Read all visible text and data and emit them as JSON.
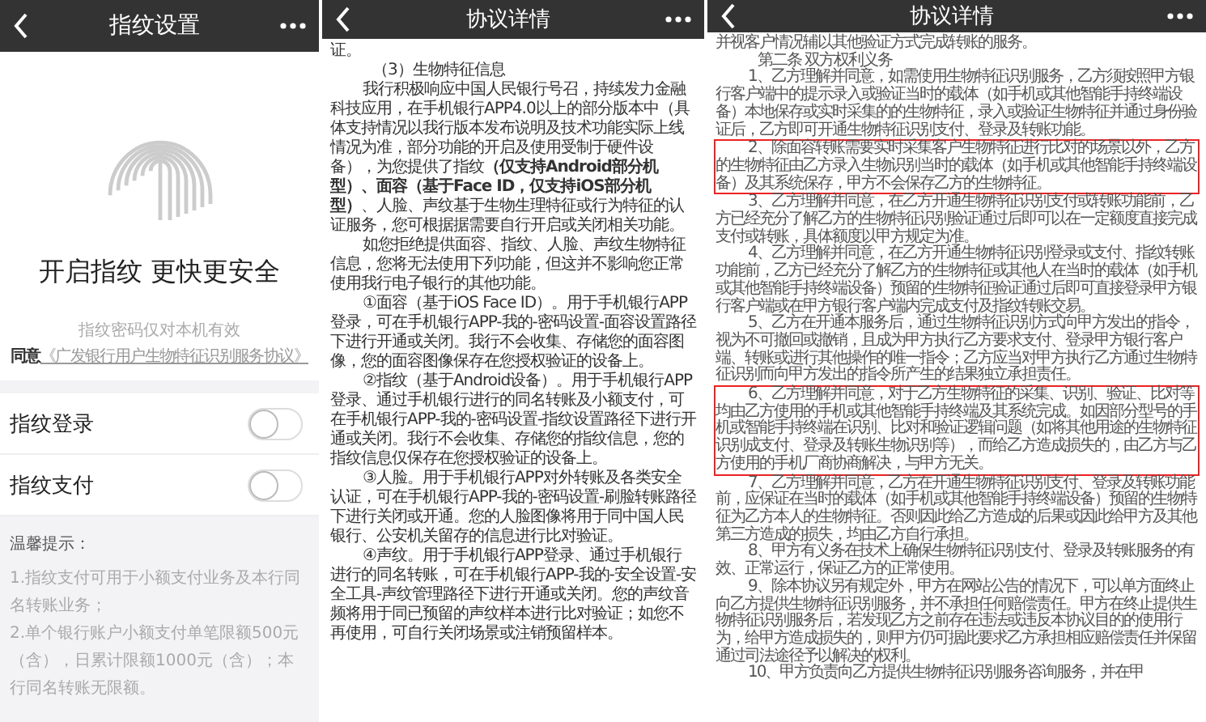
{
  "screens": [
    {
      "kind": "settings",
      "header": {
        "title": "指纹设置"
      },
      "hero": {
        "title": "开启指纹 更快更安全",
        "note": "指纹密码仅对本机有效",
        "agree": "同意",
        "agreement_link": "《广发银行用户生物特征识别服务协议》"
      },
      "toggles": [
        {
          "label": "指纹登录",
          "on": false
        },
        {
          "label": "指纹支付",
          "on": false
        }
      ],
      "tips": {
        "title": "温馨提示：",
        "lines": [
          "1.指纹支付可用于小额支付业务及本行同名转账业务；",
          "2.单个银行账户小额支付单笔限额500元（含），日累计限额1000元（含）；本行同名转账无限额。"
        ]
      }
    },
    {
      "kind": "agreement",
      "header": {
        "title": "协议详情"
      },
      "paragraphs": [
        {
          "kind": "continuation",
          "text": "证。"
        },
        {
          "kind": "heading",
          "text": "（3）生物特征信息"
        },
        {
          "kind": "body",
          "text": "我行积极响应中国人民银行号召，持续发力金融科技应用，在手机银行APP4.0以上的部分版本中（具体支持情况以我行版本发布说明及技术功能实际上线情况为准，部分功能的开启及使用受制于硬件设备），为您提供了指纹**（仅支持Android部分机型）、面容（基于Face ID，仅支持iOS部分机型）**、人脸、声纹基于生物生理特征或行为特征的认证服务，您可根据据需要自行开启或关闭相关功能。"
        },
        {
          "kind": "body",
          "text": "如您拒绝提供面容、指纹、人脸、声纹生物特征信息，您将无法使用下列功能，但这并不影响您正常使用我行电子银行的其他功能。"
        },
        {
          "kind": "body",
          "text": "①面容（基于iOS Face ID）。用于手机银行APP登录，可在手机银行APP-我的-密码设置-面容设置路径下进行开通或关闭。我行不会收集、存储您的面容图像，您的面容图像保存在您授权验证的设备上。"
        },
        {
          "kind": "body",
          "text": "②指纹（基于Android设备）。用于手机银行APP登录、通过手机银行进行的同名转账及小额支付，可在手机银行APP-我的-密码设置-指纹设置路径下进行开通或关闭。我行不会收集、存储您的指纹信息，您的指纹信息仅保存在您授权验证的设备上。"
        },
        {
          "kind": "body",
          "text": "③人脸。用于手机银行APP对外转账及各类安全认证，可在手机银行APP-我的-密码设置-刷脸转账路径下进行关闭或开通。您的人脸图像将用于同中国人民银行、公安机关留存的信息进行比对验证。"
        },
        {
          "kind": "body",
          "text": "④声纹。用于手机银行APP登录、通过手机银行进行的同名转账，可在手机银行APP-我的-安全设置-安全工具-声纹管理路径下进行开通或关闭。您的声纹音频将用于同已预留的声纹样本进行比对验证；如您不再使用，可自行关闭场景或注销预留样本。"
        }
      ]
    },
    {
      "kind": "agreement",
      "header": {
        "title": "协议详情"
      },
      "paragraphs": [
        {
          "kind": "continuation",
          "text": "并视客户情况辅以其他验证方式完成转账的服务。",
          "highlighted": false
        },
        {
          "kind": "heading",
          "text": "第二条 双方权利义务",
          "highlighted": false
        },
        {
          "kind": "body",
          "text": "1、乙方理解并同意，如需使用生物特征识别服务，乙方须按照甲方银行客户端中的提示录入或验证当时的载体（如手机或其他智能手持终端设备）本地保存或实时采集的的生物特征，录入或验证生物特征并通过身份验证后，乙方即可开通生物特征识别支付、登录及转账功能。",
          "highlighted": false
        },
        {
          "kind": "body",
          "text": "2、除面容转账需要实时采集客户生物特征进行比对的场景以外，乙方的生物特征由乙方录入生物识别当时的载体（如手机或其他智能手持终端设备）及其系统保存，甲方不会保存乙方的生物特征。",
          "highlighted": true
        },
        {
          "kind": "body",
          "text": "3、乙方理解并同意，在乙方开通生物特征识别支付或转账功能前，乙方已经充分了解乙方的生物特征识别验证通过后即可以在一定额度直接完成支付或转账，具体额度以甲方规定为准。",
          "highlighted": false
        },
        {
          "kind": "body",
          "text": "4、乙方理解并同意，在乙方开通生物特征识别登录或支付、指纹转账功能前，乙方已经充分了解乙方的生物特征或其他人在当时的载体（如手机或其他智能手持终端设备）预留的生物特征验证通过后即可直接登录甲方银行客户端或在甲方银行客户端内完成支付及指纹转账交易。",
          "highlighted": false
        },
        {
          "kind": "body",
          "text": "5、乙方在开通本服务后，通过生物特征识别方式向甲方发出的指令，视为不可撤回或撤销，且成为甲方执行乙方要求支付、登录甲方银行客户端、转账或进行其他操作的唯一指令；乙方应当对甲方执行乙方通过生物特征识别而向甲方发出的指令所产生的结果独立承担责任。",
          "highlighted": false
        },
        {
          "kind": "body",
          "text": "6、乙方理解并同意，对于乙方生物特征的采集、识别、验证、比对等均由乙方使用的手机或其他智能手持终端及其系统完成。如因部分型号的手机或智能手持终端在识别、比对和验证逻辑问题（如将其他用途的生物特征识别成支付、登录及转账生物识别等），而给乙方造成损失的，由乙方与乙方使用的手机厂商协商解决，与甲方无关。",
          "highlighted": true
        },
        {
          "kind": "body",
          "text": "7、乙方理解并同意，乙方在开通生物特征识别支付、登录及转账功能前，应保证在当时的载体（如手机或其他智能手持终端设备）预留的生物特征为乙方本人的生物特征。否则因此给乙方造成的后果或因此给甲方及其他第三方造成的损失，均由乙方自行承担。",
          "highlighted": false
        },
        {
          "kind": "body",
          "text": "8、甲方有义务在技术上确保生物特征识别支付、登录及转账服务的有效、正常运行，保证乙方的正常使用。",
          "highlighted": false
        },
        {
          "kind": "body",
          "text": "9、除本协议另有规定外，甲方在网站公告的情况下，可以单方面终止向乙方提供生物特征识别服务，并不承担任何赔偿责任。甲方在终止提供生物特征识别服务后，若发现乙方之前存在违法或违反本协议目的的使用行为，给甲方造成损失的，则甲方仍可据此要求乙方承担相应赔偿责任并保留通过司法途径予以解决的权利。",
          "highlighted": false
        },
        {
          "kind": "body",
          "text": "10、甲方负责向乙方提供生物特征识别服务咨询服务，并在甲",
          "highlighted": false
        }
      ]
    }
  ]
}
